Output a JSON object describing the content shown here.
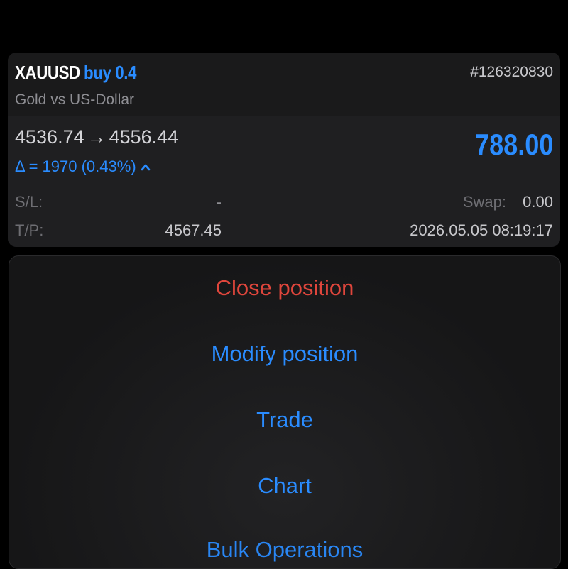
{
  "position": {
    "symbol": "XAUUSD",
    "side_volume": "buy 0.4",
    "order_id": "#126320830",
    "description": "Gold vs US-Dollar",
    "open_price": "4536.74",
    "arrow": "→",
    "current_price": "4556.44",
    "delta": "Δ = 1970 (0.43%)",
    "profit": "788.00",
    "sl_label": "S/L:",
    "sl_value": "-",
    "swap_label": "Swap:",
    "swap_value": "0.00",
    "tp_label": "T/P:",
    "tp_value": "4567.45",
    "open_time": "2026.05.05 08:19:17"
  },
  "actions": {
    "close": "Close position",
    "modify": "Modify position",
    "trade": "Trade",
    "chart": "Chart",
    "bulk": "Bulk Operations"
  },
  "colors": {
    "accent": "#2a8cff",
    "destructive": "#e0463c",
    "background": "#000000",
    "card": "#1c1c1e"
  },
  "icons": {
    "delta_trend": "chevron-up-icon"
  }
}
